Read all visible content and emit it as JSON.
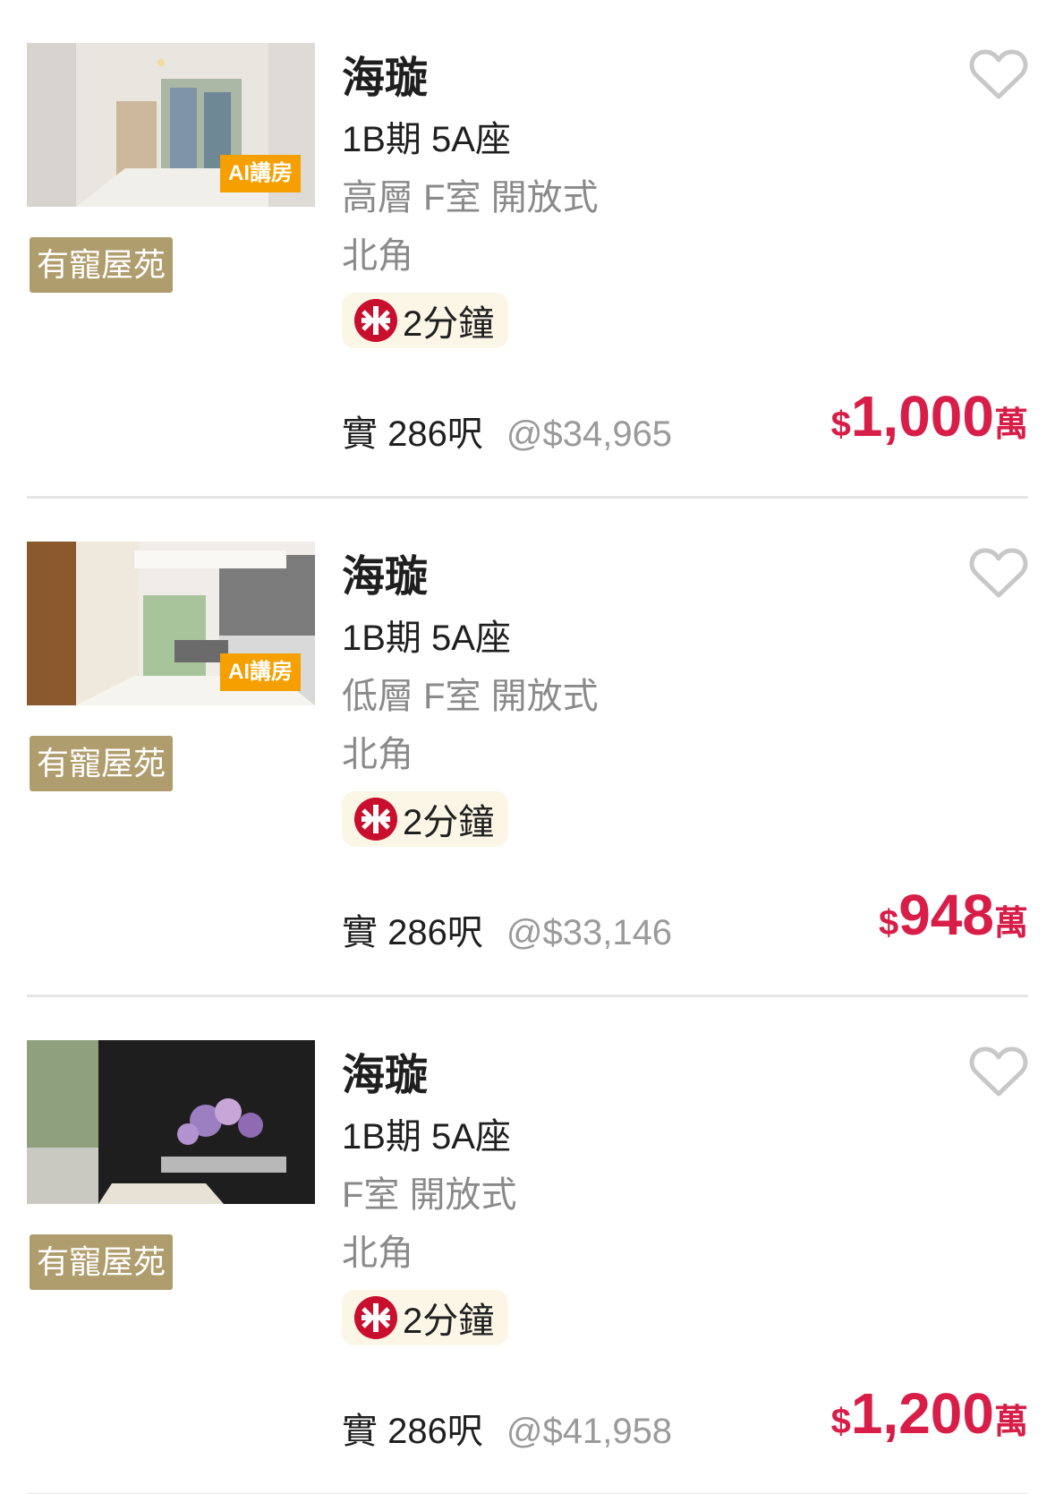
{
  "listings": [
    {
      "ai_badge": "AI講房",
      "pet_tag": "有寵屋苑",
      "estate": "海璇",
      "phase_block": "1B期 5A座",
      "floor_unit": "高層 F室 開放式",
      "district": "北角",
      "mtr_walk": "2分鐘",
      "area": "實 286呎",
      "unit_price": "@$34,965",
      "price_currency": "$",
      "price_value": "1,000",
      "price_unit": "萬"
    },
    {
      "ai_badge": "AI講房",
      "pet_tag": "有寵屋苑",
      "estate": "海璇",
      "phase_block": "1B期 5A座",
      "floor_unit": "低層 F室 開放式",
      "district": "北角",
      "mtr_walk": "2分鐘",
      "area": "實 286呎",
      "unit_price": "@$33,146",
      "price_currency": "$",
      "price_value": "948",
      "price_unit": "萬"
    },
    {
      "ai_badge": "",
      "pet_tag": "有寵屋苑",
      "estate": "海璇",
      "phase_block": "1B期 5A座",
      "floor_unit": "F室 開放式",
      "district": "北角",
      "mtr_walk": "2分鐘",
      "area": "實 286呎",
      "unit_price": "@$41,958",
      "price_currency": "$",
      "price_value": "1,200",
      "price_unit": "萬"
    }
  ],
  "colors": {
    "price": "#d81e48",
    "pet_tag_bg": "#b09d6e",
    "ai_badge_bg": "#f5a000",
    "mtr_bg": "#fbf6e6",
    "mtr_icon": "#c8102e"
  },
  "icons": {
    "favorite": "heart-outline-icon",
    "mtr": "mtr-logo-icon"
  }
}
